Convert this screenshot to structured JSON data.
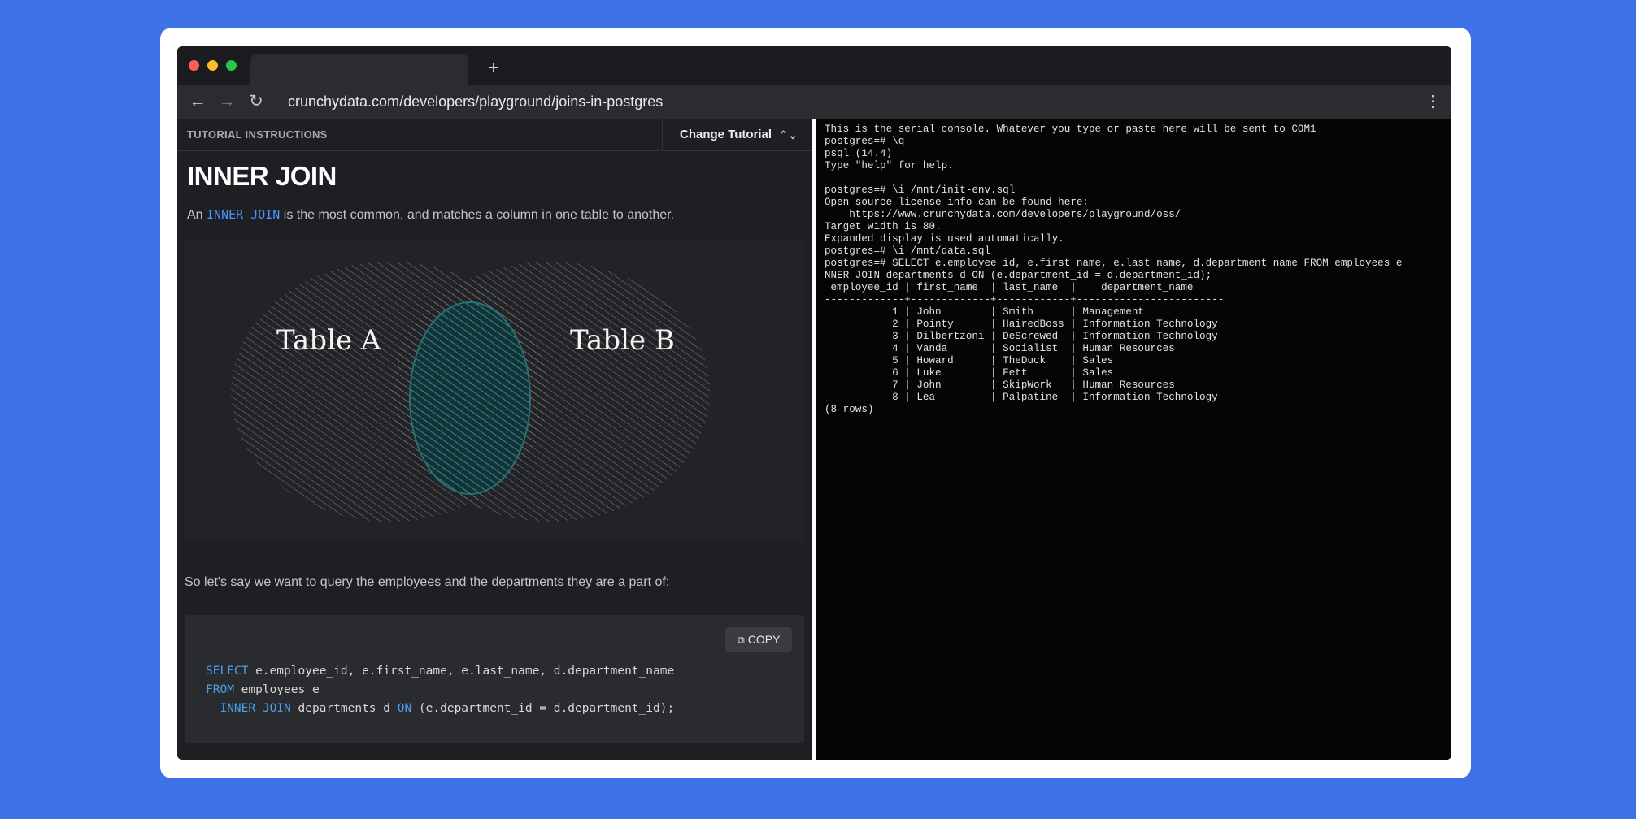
{
  "browser": {
    "new_tab_label": "+",
    "back_icon": "←",
    "forward_icon": "→",
    "reload_icon": "↻",
    "menu_icon": "⋮",
    "url": "crunchydata.com/developers/playground/joins-in-postgres"
  },
  "tutorial": {
    "header_label": "TUTORIAL INSTRUCTIONS",
    "change_tutorial_label": "Change Tutorial",
    "updown_icon": "⌃⌄",
    "title": "INNER JOIN",
    "intro_prefix": "An",
    "intro_keyword": "INNER JOIN",
    "intro_suffix": "is the most common, and matches a column in one table to another.",
    "venn": {
      "left_label": "Table A",
      "right_label": "Table B"
    },
    "paragraph2": "So let's say we want to query the employees and the departments they are a part of:",
    "copy_label": "COPY",
    "code": {
      "line1_kw": "SELECT",
      "line1_rest": " e.employee_id, e.first_name, e.last_name, d.department_name",
      "line2_kw": "FROM",
      "line2_rest": " employees e",
      "line3_kw1": "  INNER JOIN",
      "line3_mid": " departments d ",
      "line3_kw2": "ON",
      "line3_rest": " (e.department_id = d.department_id);"
    }
  },
  "console": {
    "lines": [
      "This is the serial console. Whatever you type or paste here will be sent to COM1",
      "postgres=# \\q",
      "psql (14.4)",
      "Type \"help\" for help.",
      "",
      "postgres=# \\i /mnt/init-env.sql",
      "Open source license info can be found here:",
      "    https://www.crunchydata.com/developers/playground/oss/",
      "Target width is 80.",
      "Expanded display is used automatically.",
      "postgres=# \\i /mnt/data.sql",
      "postgres=# SELECT e.employee_id, e.first_name, e.last_name, d.department_name FROM employees e",
      "NNER JOIN departments d ON (e.department_id = d.department_id);",
      " employee_id | first_name  | last_name  |    department_name",
      "-------------+-------------+------------+------------------------",
      "           1 | John        | Smith      | Management",
      "           2 | Pointy      | HairedBoss | Information Technology",
      "           3 | Dilbertzoni | DeScrewed  | Information Technology",
      "           4 | Vanda       | Socialist  | Human Resources",
      "           5 | Howard      | TheDuck    | Sales",
      "           6 | Luke        | Fett       | Sales",
      "           7 | John        | SkipWork   | Human Resources",
      "           8 | Lea         | Palpatine  | Information Technology",
      "(8 rows)"
    ]
  }
}
